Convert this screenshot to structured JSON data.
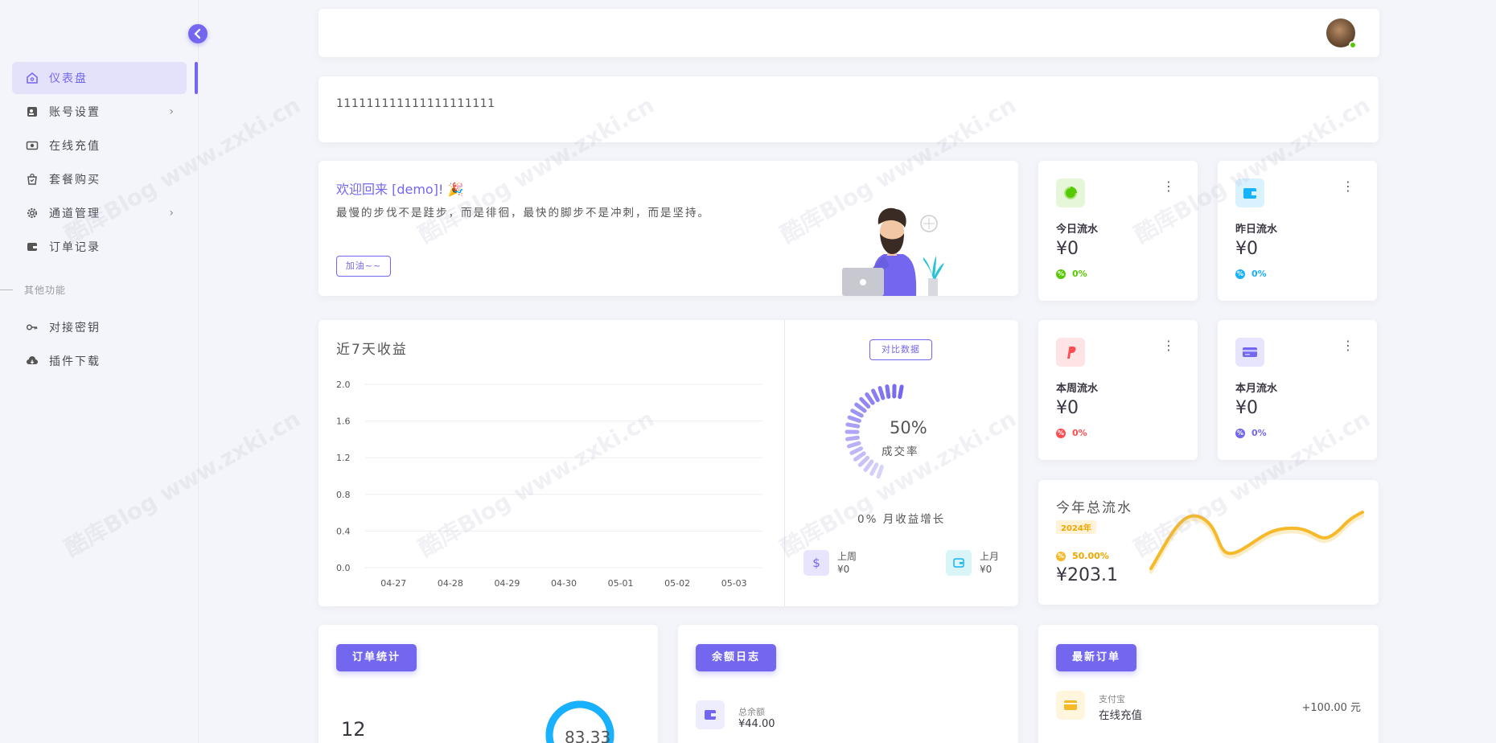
{
  "sidebar": {
    "collapse_icon": "chevron-left-icon",
    "items": [
      {
        "label": "仪表盘",
        "icon": "home-icon",
        "active": true
      },
      {
        "label": "账号设置",
        "icon": "user-card-icon",
        "has_arrow": true
      },
      {
        "label": "在线充值",
        "icon": "money-icon"
      },
      {
        "label": "套餐购买",
        "icon": "shopping-bag-icon"
      },
      {
        "label": "通道管理",
        "icon": "gear-icon",
        "has_arrow": true
      },
      {
        "label": "订单记录",
        "icon": "wallet-icon"
      }
    ],
    "section_title": "其他功能",
    "items2": [
      {
        "label": "对接密钥",
        "icon": "key-icon"
      },
      {
        "label": "插件下载",
        "icon": "cloud-download-icon"
      }
    ],
    "arrow": "›"
  },
  "notice": {
    "text": "111111111111111111111"
  },
  "welcome": {
    "title": "欢迎回来 [demo]! 🎉",
    "text": "最慢的步伐不是跬步，而是徘徊，最快的脚步不是冲刺，而是坚持。",
    "button": "加油~~"
  },
  "stats": [
    {
      "label": "今日流水",
      "value": "¥0",
      "pct": "0%",
      "color": "#56ca00",
      "bg": "#e6f7d9",
      "icon": "pie-chart-icon"
    },
    {
      "label": "昨日流水",
      "value": "¥0",
      "pct": "0%",
      "color": "#16b1ff",
      "bg": "#d9f2ff",
      "icon": "wallet-icon"
    },
    {
      "label": "本周流水",
      "value": "¥0",
      "pct": "0%",
      "color": "#ff4c51",
      "bg": "#ffe4e5",
      "icon": "paypal-icon"
    },
    {
      "label": "本月流水",
      "value": "¥0",
      "pct": "0%",
      "color": "#7367f0",
      "bg": "#e7e5fd",
      "icon": "credit-card-icon"
    }
  ],
  "revenue": {
    "title": "近7天收益",
    "compare_button": "对比数据",
    "gauge_pct": "50%",
    "gauge_label": "成交率",
    "growth": "0% 月收益增长",
    "last_week": {
      "label": "上周",
      "value": "¥0",
      "icon": "dollar-icon"
    },
    "last_month": {
      "label": "上月",
      "value": "¥0",
      "icon": "wallet-icon"
    }
  },
  "chart_data": {
    "type": "line",
    "categories": [
      "04-27",
      "04-28",
      "04-29",
      "04-30",
      "05-01",
      "05-02",
      "05-03"
    ],
    "values": [
      0,
      0,
      0,
      0,
      0,
      0,
      0
    ],
    "yticks": [
      "2.0",
      "1.6",
      "1.2",
      "0.8",
      "0.4",
      "0.0"
    ],
    "ylim": [
      0,
      2
    ],
    "title": "近7天收益",
    "grid": true
  },
  "yearly": {
    "title": "今年总流水",
    "badge": "2024年",
    "pct": "50.00%",
    "value": "¥203.1",
    "color": "#f5b929"
  },
  "orders": {
    "button": "订单统计",
    "count": "12",
    "donut_value": "83.33"
  },
  "balance": {
    "button": "余额日志",
    "label": "总余额",
    "value": "¥44.00"
  },
  "latest": {
    "button": "最新订单",
    "label": "支付宝",
    "type": "在线充值",
    "amount": "+100.00 元"
  },
  "colors": {
    "accent": "#7367f0"
  }
}
